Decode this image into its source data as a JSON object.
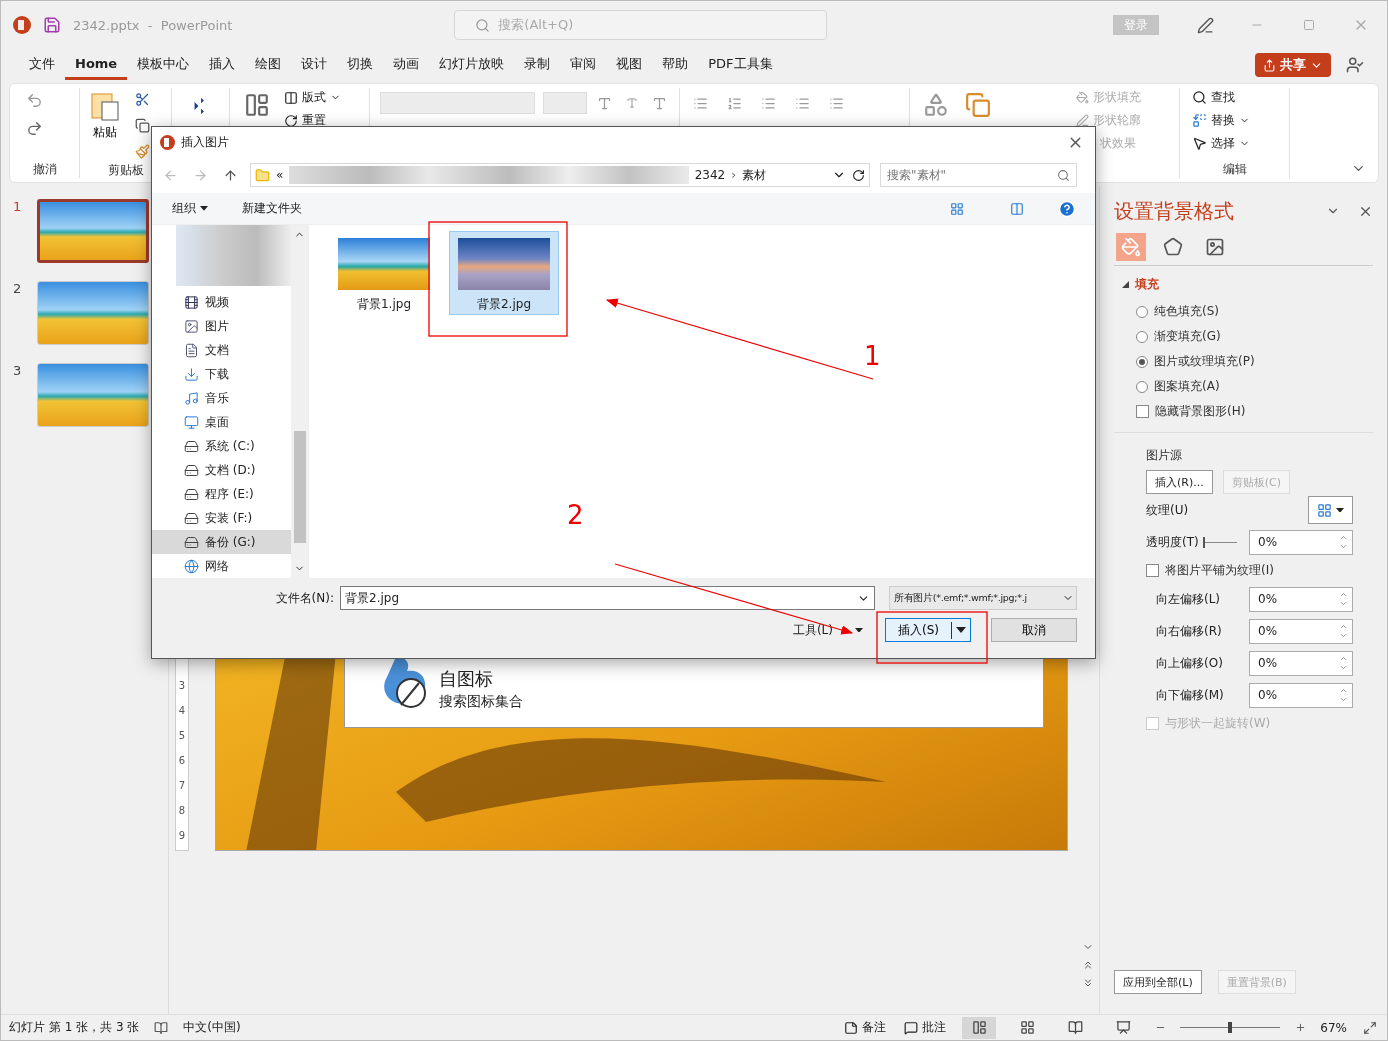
{
  "app": {
    "file_name": "2342.pptx",
    "separator": "-",
    "app_name": "PowerPoint",
    "search_placeholder": "搜索(Alt+Q)",
    "login": "登录",
    "share": "共享"
  },
  "menu": [
    {
      "label": "文件",
      "selected": false
    },
    {
      "label": "Home",
      "selected": true
    },
    {
      "label": "模板中心",
      "selected": false
    },
    {
      "label": "插入",
      "selected": false
    },
    {
      "label": "绘图",
      "selected": false
    },
    {
      "label": "设计",
      "selected": false
    },
    {
      "label": "切换",
      "selected": false
    },
    {
      "label": "动画",
      "selected": false
    },
    {
      "label": "幻灯片放映",
      "selected": false
    },
    {
      "label": "录制",
      "selected": false
    },
    {
      "label": "审阅",
      "selected": false
    },
    {
      "label": "视图",
      "selected": false
    },
    {
      "label": "帮助",
      "selected": false
    },
    {
      "label": "PDF工具集",
      "selected": false
    }
  ],
  "ribbon": {
    "undo_group": "撤消",
    "paste": "粘贴",
    "clipboard_group": "剪贴板",
    "layout": "版式",
    "reset": "重置",
    "shape_fill": "形状填充",
    "shape_outline": "形状轮廓",
    "shape_effects": "状效果",
    "find": "查找",
    "replace": "替换",
    "select": "选择",
    "editing_group": "编辑"
  },
  "slides": [
    {
      "number": "1",
      "selected": true
    },
    {
      "number": "2",
      "selected": false
    },
    {
      "number": "3",
      "selected": false
    }
  ],
  "ruler": [
    "3",
    "4",
    "5",
    "6",
    "7",
    "8",
    "9"
  ],
  "slide": {
    "icon_title": "自图标",
    "icon_subtitle": "搜索图标集合"
  },
  "dialog": {
    "title": "插入图片",
    "path_prefix": "«",
    "path": [
      "2342",
      "素材"
    ],
    "path_separator": "›",
    "search_placeholder": "搜索\"素材\"",
    "organize": "组织",
    "new_folder": "新建文件夹",
    "nav": [
      {
        "label": "视频",
        "kind": "video",
        "selected": false
      },
      {
        "label": "图片",
        "kind": "pictures",
        "selected": false
      },
      {
        "label": "文档",
        "kind": "documents",
        "selected": false
      },
      {
        "label": "下载",
        "kind": "downloads",
        "selected": false
      },
      {
        "label": "音乐",
        "kind": "music",
        "selected": false
      },
      {
        "label": "桌面",
        "kind": "desktop",
        "selected": false
      },
      {
        "label": "系统 (C:)",
        "kind": "system",
        "selected": false
      },
      {
        "label": "文档 (D:)",
        "kind": "drive",
        "selected": false
      },
      {
        "label": "程序 (E:)",
        "kind": "drive",
        "selected": false
      },
      {
        "label": "安装 (F:)",
        "kind": "drive",
        "selected": false
      },
      {
        "label": "备份 (G:)",
        "kind": "drive",
        "selected": true
      },
      {
        "label": "网络",
        "kind": "network",
        "selected": false
      }
    ],
    "files": [
      {
        "name": "背景1.jpg",
        "kind": "palm",
        "selected": false
      },
      {
        "name": "背景2.jpg",
        "kind": "sunset",
        "selected": true
      }
    ],
    "file_name_label": "文件名(N):",
    "file_name_value": "背景2.jpg",
    "filter": "所有图片(*.emf;*.wmf;*.jpg;*.j",
    "tools": "工具(L)",
    "insert": "插入(S)",
    "cancel": "取消"
  },
  "pane": {
    "title": "设置背景格式",
    "tabs": [
      {
        "kind": "fill",
        "selected": true
      },
      {
        "kind": "effects",
        "selected": false
      },
      {
        "kind": "picture",
        "selected": false
      }
    ],
    "section": "填充",
    "expanded": true,
    "fill_options": [
      {
        "label": "纯色填充(S)",
        "selected": false
      },
      {
        "label": "渐变填充(G)",
        "selected": false
      },
      {
        "label": "图片或纹理填充(P)",
        "selected": true
      },
      {
        "label": "图案填充(A)",
        "selected": false
      }
    ],
    "hide_graphics": {
      "label": "隐藏背景图形(H)",
      "checked": false
    },
    "source_label": "图片源",
    "insert": "插入(R)...",
    "clipboard": {
      "label": "剪贴板(C)",
      "disabled": true
    },
    "texture_label": "纹理(U)",
    "transparency": {
      "label": "透明度(T)",
      "level": 0,
      "value": "0%"
    },
    "tile": {
      "label": "将图片平铺为纹理(I)",
      "checked": false
    },
    "offsets": [
      {
        "label": "向左偏移(L)",
        "value": "0%"
      },
      {
        "label": "向右偏移(R)",
        "value": "0%"
      },
      {
        "label": "向上偏移(O)",
        "value": "0%"
      },
      {
        "label": "向下偏移(M)",
        "value": "0%"
      }
    ],
    "rotate": {
      "label": "与形状一起旋转(W)",
      "checked": false,
      "disabled": true
    },
    "apply_all": "应用到全部(L)",
    "reset": {
      "label": "重置背景(B)",
      "disabled": true
    }
  },
  "status": {
    "slide_info": "幻灯片 第 1 张，共 3 张",
    "language": "中文(中国)",
    "notes": "备注",
    "comments": "批注",
    "views": [
      {
        "kind": "normal",
        "selected": true
      },
      {
        "kind": "sorter",
        "selected": false
      },
      {
        "kind": "reading",
        "selected": false
      },
      {
        "kind": "show",
        "selected": false
      }
    ],
    "zoom": {
      "level": 0.5,
      "value": "67%"
    }
  },
  "annotations": [
    "1",
    "2"
  ]
}
